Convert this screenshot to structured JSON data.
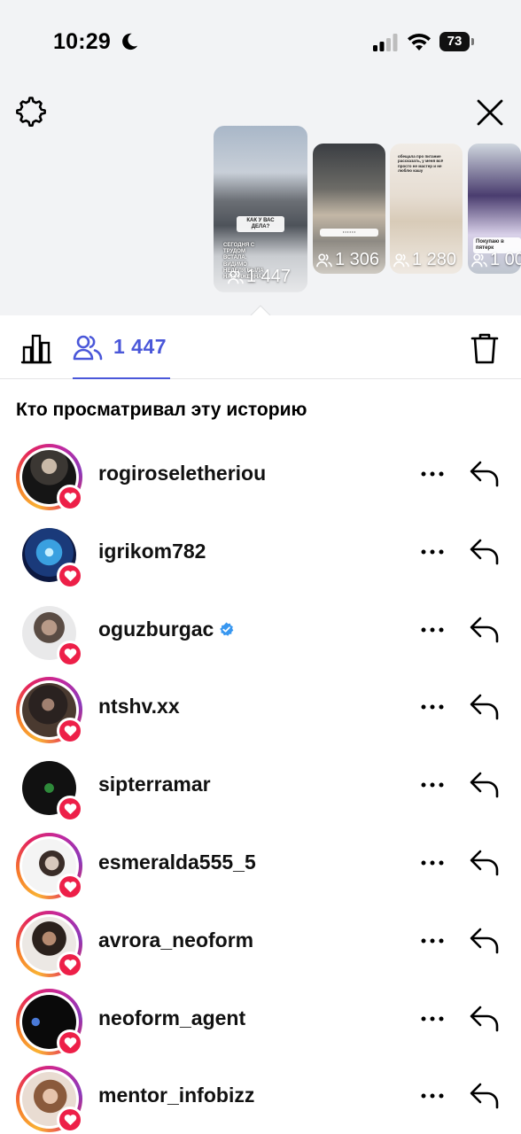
{
  "status_bar": {
    "time": "10:29",
    "battery": "73"
  },
  "stories": [
    {
      "views": "1 447",
      "sticker_1": "КАК У ВАС ДЕЛА?",
      "sticker_2": "СЕГОДНЯ С ТРУДОМ ВСТАЛА. ВИДИМО НЕДЕЛЯ БЫЛА НАПРЯЖЕННАЯ"
    },
    {
      "views": "1 306"
    },
    {
      "views": "1 280",
      "sticker_1": "обещала про питание рассказать, у меня всё просто не мастер и не люблю кашу"
    },
    {
      "views": "1 00",
      "sticker_1": "Покупаю в пятерк"
    }
  ],
  "tabs": {
    "viewers_count": "1 447"
  },
  "section_title": "Кто просматривал эту историю",
  "viewers": [
    {
      "username": "rogiroseletheriou",
      "ring": true,
      "verified": false
    },
    {
      "username": "igrikom782",
      "ring": false,
      "verified": false
    },
    {
      "username": "oguzburgac",
      "ring": false,
      "verified": true
    },
    {
      "username": "ntshv.xx",
      "ring": true,
      "verified": false
    },
    {
      "username": "sipterramar",
      "ring": false,
      "verified": false
    },
    {
      "username": "esmeralda555_5",
      "ring": true,
      "verified": false
    },
    {
      "username": "avrora_neoform",
      "ring": true,
      "verified": false
    },
    {
      "username": "neoform_agent",
      "ring": true,
      "verified": false
    },
    {
      "username": "mentor_infobizz",
      "ring": true,
      "verified": false
    }
  ],
  "colors": {
    "accent": "#4a57d9",
    "heart": "#ed1f48",
    "verified": "#3897f0",
    "top_bg": "#f2f3f5"
  },
  "icons": [
    "moon-icon",
    "signal-icon",
    "wifi-icon",
    "battery-icon",
    "gear-icon",
    "close-icon",
    "people-icon",
    "bar-chart-icon",
    "trash-icon",
    "heart-icon",
    "more-icon",
    "reply-icon",
    "verified-icon"
  ]
}
